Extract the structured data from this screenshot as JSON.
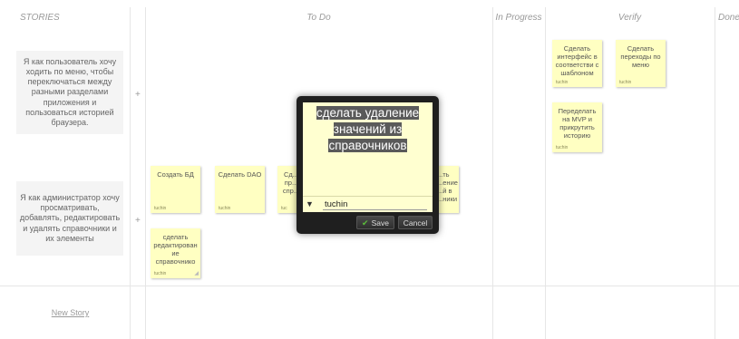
{
  "columns": {
    "stories": "STORIES",
    "todo": "To Do",
    "in_progress": "In Progress",
    "verify": "Verify",
    "done": "Done"
  },
  "stories": [
    {
      "text": "Я как пользователь хочу ходить по меню, чтобы переключаться между разными разделами приложения и пользоваться историей браузера.",
      "add": "+"
    },
    {
      "text": "Я как администратор хочу просматривать, добавлять, редактировать и удалять справочники и их элементы",
      "add": "+"
    }
  ],
  "new_story": "New Story",
  "verify_notes": [
    {
      "title": "Сделать интерфейс в соответстви с шаблоном",
      "owner": "tuchin"
    },
    {
      "title": "Сделать переходы по меню",
      "owner": "tuchin"
    },
    {
      "title": "Переделать на MVP и прикрутить историю",
      "owner": "tuchin"
    }
  ],
  "todo_notes": [
    {
      "title": "Создать БД",
      "owner": "tuchin"
    },
    {
      "title": "Сделать DAO",
      "owner": "tuchin"
    },
    {
      "title": "Сд... пр... спр...",
      "owner": "tuc"
    },
    {
      "title": "...ть ...ение ...й в ...ники",
      "owner": ""
    },
    {
      "title": "сделать редактирован ие справочнико",
      "owner": "tuchin"
    }
  ],
  "editor": {
    "text": "сделать удаление значений из справочников",
    "owner": "tuchin",
    "save_label": "Save",
    "cancel_label": "Cancel"
  }
}
